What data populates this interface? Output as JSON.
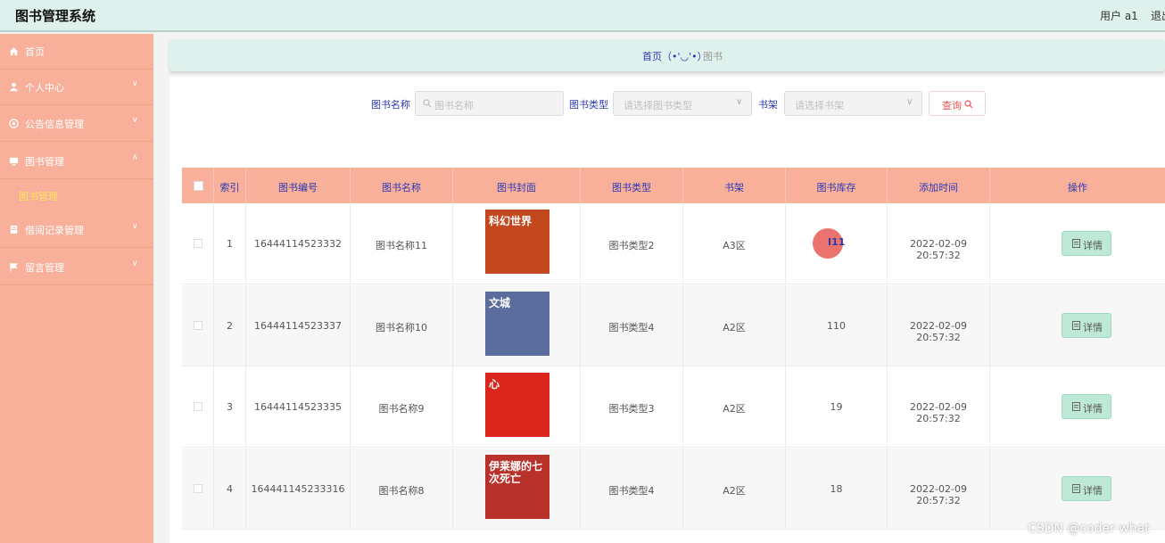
{
  "app": {
    "title": "图书管理系统",
    "user": "用户 a1",
    "logout": "退出"
  },
  "sidebar": {
    "items": [
      {
        "label": "首页",
        "icon": "home-icon",
        "arrow": ""
      },
      {
        "label": "个人中心",
        "icon": "user-icon",
        "arrow": "∨"
      },
      {
        "label": "公告信息管理",
        "icon": "notice-icon",
        "arrow": "∨"
      },
      {
        "label": "图书管理",
        "icon": "monitor-icon",
        "arrow": "∧"
      },
      {
        "label": "借阅记录管理",
        "icon": "document-icon",
        "arrow": "∨"
      },
      {
        "label": "留言管理",
        "icon": "flag-icon",
        "arrow": "∨"
      }
    ],
    "submenu": "图书管理"
  },
  "breadcrumb": {
    "home": "首页（•'◡'•）",
    "current": "图书"
  },
  "filters": {
    "name_label": "图书名称",
    "name_placeholder": "图书名称",
    "type_label": "图书类型",
    "type_placeholder": "请选择图书类型",
    "shelf_label": "书架",
    "shelf_placeholder": "请选择书架",
    "search_button": "查询"
  },
  "table": {
    "headers": [
      "索引",
      "图书编号",
      "图书名称",
      "图书封面",
      "图书类型",
      "书架",
      "图书库存",
      "添加时间",
      "操作"
    ],
    "rows": [
      {
        "index": "1",
        "code": "16444114523332",
        "name": "图书名称11",
        "type": "图书类型2",
        "shelf": "A3区",
        "stock": "",
        "time": "2022-02-09 20:57:32",
        "cover_text": "科幻世界",
        "cover_color": "#c4481e"
      },
      {
        "index": "2",
        "code": "16444114523337",
        "name": "图书名称10",
        "type": "图书类型4",
        "shelf": "A2区",
        "stock": "110",
        "time": "2022-02-09 20:57:32",
        "cover_text": "文城",
        "cover_color": "#5b6d9d"
      },
      {
        "index": "3",
        "code": "16444114523335",
        "name": "图书名称9",
        "type": "图书类型3",
        "shelf": "A2区",
        "stock": "19",
        "time": "2022-02-09 20:57:32",
        "cover_text": "心",
        "cover_color": "#d9251c"
      },
      {
        "index": "4",
        "code": "164441145233316",
        "name": "图书名称8",
        "type": "图书类型4",
        "shelf": "A2区",
        "stock": "18",
        "time": "2022-02-09 20:57:32",
        "cover_text": "伊莱娜的七次死亡",
        "cover_color": "#b8312a"
      }
    ],
    "detail_button": "详情"
  },
  "cursor_text": "I11",
  "watermark": "CSDN @coder what"
}
